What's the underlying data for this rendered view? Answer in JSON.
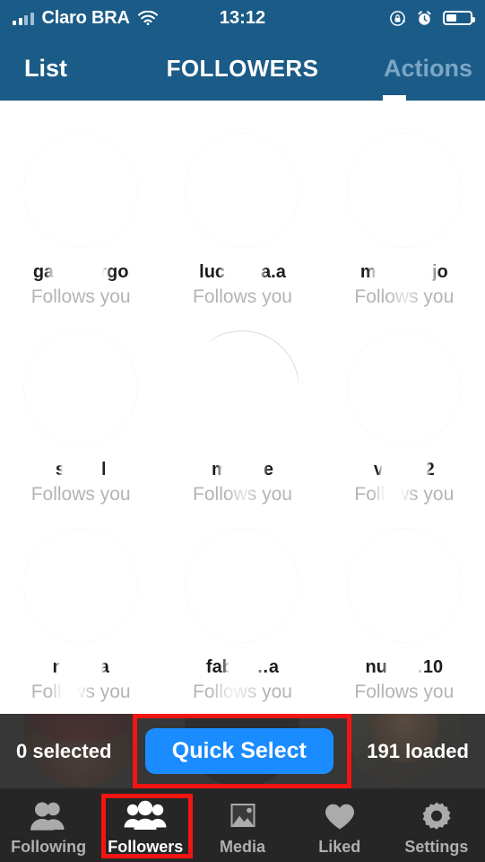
{
  "status_bar": {
    "carrier": "Claro BRA",
    "wifi_icon": "wifi-icon",
    "clock": "13:12",
    "rotation_lock_icon": "rotation-lock-icon",
    "alarm_icon": "alarm-clock-icon",
    "battery_icon": "battery-icon",
    "battery_level_percent": 42
  },
  "nav_bar": {
    "left_label": "List",
    "title": "FOLLOWERS",
    "right_label": "Actions"
  },
  "grid": {
    "rows": [
      {
        "cells": [
          {
            "name": "ga……argo",
            "subtitle": "Follows you",
            "avatar": "user-avatar"
          },
          {
            "name": "luc……a.a",
            "subtitle": "Follows you",
            "avatar": "user-avatar"
          },
          {
            "name": "m……sejo",
            "subtitle": "Follows you",
            "avatar": "user-avatar"
          }
        ]
      },
      {
        "cells": [
          {
            "name": "s……l",
            "subtitle": "Follows you",
            "avatar": "user-avatar"
          },
          {
            "name": "m……e",
            "subtitle": "Follows you",
            "avatar": "user-avatar"
          },
          {
            "name": "vi……2",
            "subtitle": "Follows you",
            "avatar": "user-avatar"
          }
        ]
      },
      {
        "cells": [
          {
            "name": "n……a",
            "subtitle": "Follows you",
            "avatar": "user-avatar"
          },
          {
            "name": "fab……a",
            "subtitle": "Follows you",
            "avatar": "user-avatar"
          },
          {
            "name": "nu……10",
            "subtitle": "Follows you",
            "avatar": "user-avatar"
          }
        ]
      }
    ]
  },
  "action_bar": {
    "selected_label": "0 selected",
    "quick_select_label": "Quick Select",
    "loaded_label": "191 loaded"
  },
  "tab_bar": {
    "items": [
      {
        "label": "Following",
        "icon": "two-people-icon",
        "active": false
      },
      {
        "label": "Followers",
        "icon": "three-people-icon",
        "active": true
      },
      {
        "label": "Media",
        "icon": "image-icon",
        "active": false
      },
      {
        "label": "Liked",
        "icon": "heart-icon",
        "active": false
      },
      {
        "label": "Settings",
        "icon": "gear-icon",
        "active": false
      }
    ]
  },
  "annotations": [
    {
      "name": "quick-select-highlight",
      "color": "#f41411"
    },
    {
      "name": "followers-tab-highlight",
      "color": "#f41411"
    }
  ],
  "colors": {
    "header_blue": "#1b5b87",
    "accent_blue": "#1a8cff",
    "tab_bar_dark": "#262626",
    "annotation_red": "#f41411",
    "muted_text": "#b4b4b4"
  }
}
